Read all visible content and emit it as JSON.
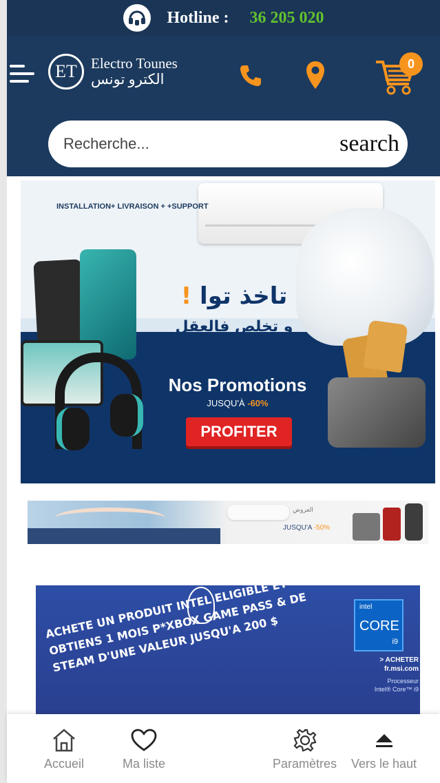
{
  "header": {
    "hotline_label": "Hotline :",
    "hotline_number": "36 205 020",
    "logo_initials": "ET",
    "logo_name_en": "Electro Tounes",
    "logo_name_ar": "الكترو تونس",
    "cart_count": "0",
    "icons": [
      "headset-icon",
      "menu-icon",
      "phone-icon",
      "location-pin-icon",
      "cart-icon"
    ]
  },
  "search": {
    "placeholder": "Recherche...",
    "button_label": "search"
  },
  "banners": {
    "main": {
      "services": "INSTALLATION+ LIVRAISON + +SUPPORT",
      "arabic_title": "تاخذ توا",
      "arabic_excl": "!",
      "arabic_subtitle": "و تخلص فالعقل",
      "promo_title": "Nos Promotions",
      "jusqua": "JUSQU'À",
      "jusqua_pct": "-60%",
      "cta": "PROFITER"
    },
    "second": {
      "arabic": "العروض",
      "jusqua": "JUSQU'A",
      "jusqua_pct": "-50%"
    },
    "third": {
      "promo_text": "ACHETE UN PRODUIT INTEL ELIGIBLE ET OBTIENS 1 MOIS P*XBOX GAME PASS & DE STEAM D'UNE VALEUR JUSQU'A 200 $",
      "intel_brand": "intel",
      "intel_core": "CORE",
      "intel_model": "i9",
      "acheter": "> ACHETER",
      "site": "fr.msi.com",
      "processor": "Processeur",
      "processor_model": "Intel® Core™ i9"
    }
  },
  "bottom_nav": {
    "items": [
      {
        "label": "Accueil",
        "icon": "home-icon"
      },
      {
        "label": "Ma liste",
        "icon": "heart-icon"
      },
      {
        "label": "Paramètres",
        "icon": "gear-icon"
      },
      {
        "label": "Vers le haut",
        "icon": "arrow-up-icon"
      }
    ]
  },
  "colors": {
    "header_bg": "#1c3a5e",
    "hotline_number": "#63c12f",
    "accent": "#f7941d",
    "cta_red": "#e02424"
  }
}
